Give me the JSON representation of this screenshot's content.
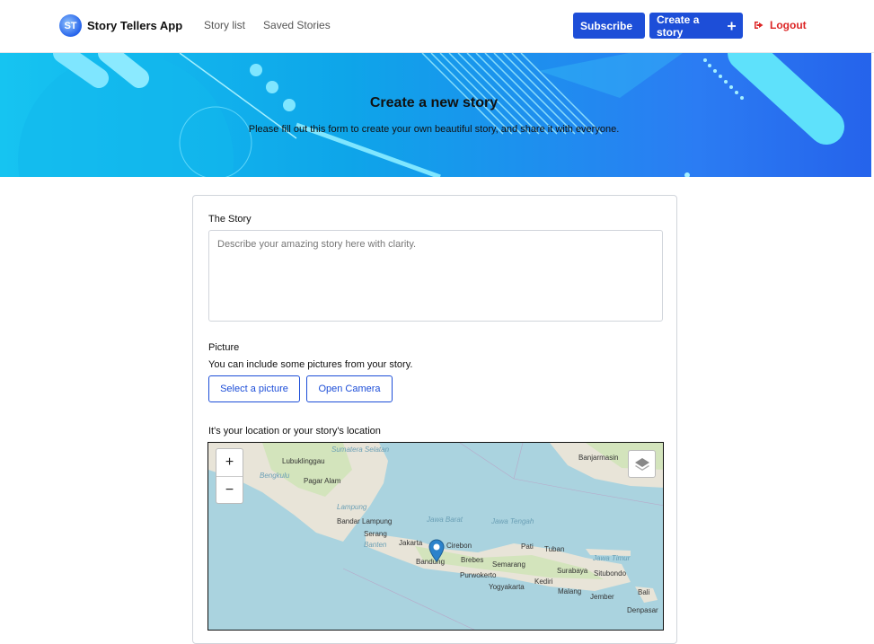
{
  "header": {
    "app_name": "Story Tellers App",
    "nav": [
      "Story list",
      "Saved Stories"
    ],
    "subscribe_label": "Subscribe",
    "create_label": "Create a story",
    "logout_label": "Logout"
  },
  "hero": {
    "title": "Create a new story",
    "subtitle": "Please fill out this form to create your own beautiful story, and share it with everyone."
  },
  "form": {
    "story_label": "The Story",
    "story_placeholder": "Describe your amazing story here with clarity.",
    "picture_label": "Picture",
    "picture_desc": "You can include some pictures from your story.",
    "select_picture_label": "Select a picture",
    "open_camera_label": "Open Camera",
    "location_label": "It's your location or your story's location"
  },
  "map": {
    "zoom_in": "+",
    "zoom_out": "−",
    "places": [
      "Sumatera Selatan",
      "Lubuklinggau",
      "Bengkulu",
      "Pagar Alam",
      "Lampung",
      "Bandar Lampung",
      "Serang",
      "Banten",
      "Jakarta",
      "Cirebon",
      "Bandung",
      "Brebes",
      "Semarang",
      "Purwokerto",
      "Yogyakarta",
      "Pati",
      "Tuban",
      "Surabaya",
      "Jawa Timur",
      "Situbondo",
      "Kediri",
      "Malang",
      "Jember",
      "Bali",
      "Denpasar",
      "Banjarmasin",
      "Jawa Barat",
      "Jawa Tengah"
    ]
  },
  "colors": {
    "primary": "#1d4ed8",
    "logout": "#dc2626"
  }
}
